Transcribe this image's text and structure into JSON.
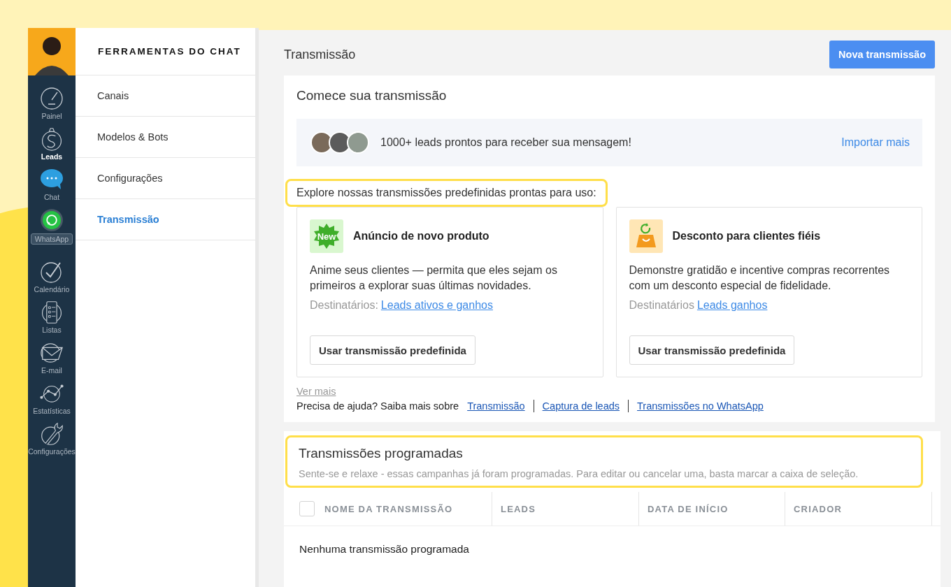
{
  "nav": {
    "items": [
      {
        "label": "Painel",
        "kind": "gauge",
        "selected": false
      },
      {
        "label": "Leads",
        "kind": "dollar",
        "selected": true
      },
      {
        "label": "Chat",
        "kind": "chat",
        "selected": false
      },
      {
        "label": "WhatsApp",
        "kind": "whatsapp",
        "selected": false
      },
      {
        "label": "Calendário",
        "kind": "check",
        "selected": false
      },
      {
        "label": "Listas",
        "kind": "list",
        "selected": false
      },
      {
        "label": "E-mail",
        "kind": "mail",
        "selected": false
      },
      {
        "label": "Estatísticas",
        "kind": "stats",
        "selected": false
      },
      {
        "label": "Configurações",
        "kind": "wrench",
        "selected": false
      }
    ]
  },
  "panel": {
    "title": "FERRAMENTAS DO CHAT",
    "items": [
      {
        "label": "Canais",
        "selected": false
      },
      {
        "label": "Modelos & Bots",
        "selected": false
      },
      {
        "label": "Configurações",
        "selected": false
      },
      {
        "label": "Transmissão",
        "selected": true
      }
    ]
  },
  "header": {
    "title": "Transmissão",
    "button": "Nova transmissão"
  },
  "start": {
    "title": "Comece sua transmissão",
    "leads_text": "1000+ leads prontos para receber sua mensagem!",
    "import_link": "Importar mais",
    "explore": "Explore nossas transmissões predefinidas prontas para uso:",
    "templates": [
      {
        "kind": "new",
        "badge": "New",
        "title": "Anúncio de novo produto",
        "text": "Anime seus clientes — permita que eles sejam os primeiros a explorar suas últimas novidades.",
        "recipients_label": "Destinatários:",
        "recipients_link": "Leads ativos e ganhos",
        "button": "Usar transmissão predefinida"
      },
      {
        "kind": "discount",
        "title": "Desconto para clientes fiéis",
        "text": "Demonstre gratidão e incentive compras recorrentes com um desconto especial de fidelidade.",
        "recipients_label": "Destinatários",
        "recipients_link": "Leads ganhos",
        "button": "Usar transmissão predefinida"
      }
    ],
    "more_link": "Ver mais",
    "help_text": "Precisa de ajuda? Saiba mais sobre",
    "help_links": [
      "Transmissão",
      "Captura de leads",
      "Transmissões no WhatsApp"
    ]
  },
  "scheduled": {
    "title": "Transmissões programadas",
    "subtitle": "Sente-se e relaxe - essas campanhas já foram programadas. Para editar ou cancelar uma, basta marcar a caixa de seleção.",
    "select_all_checked": false,
    "columns": [
      "NOME DA TRANSMISSÃO",
      "LEADS",
      "DATA DE INÍCIO",
      "CRIADOR"
    ],
    "empty": "Nenhuma transmissão programada"
  }
}
